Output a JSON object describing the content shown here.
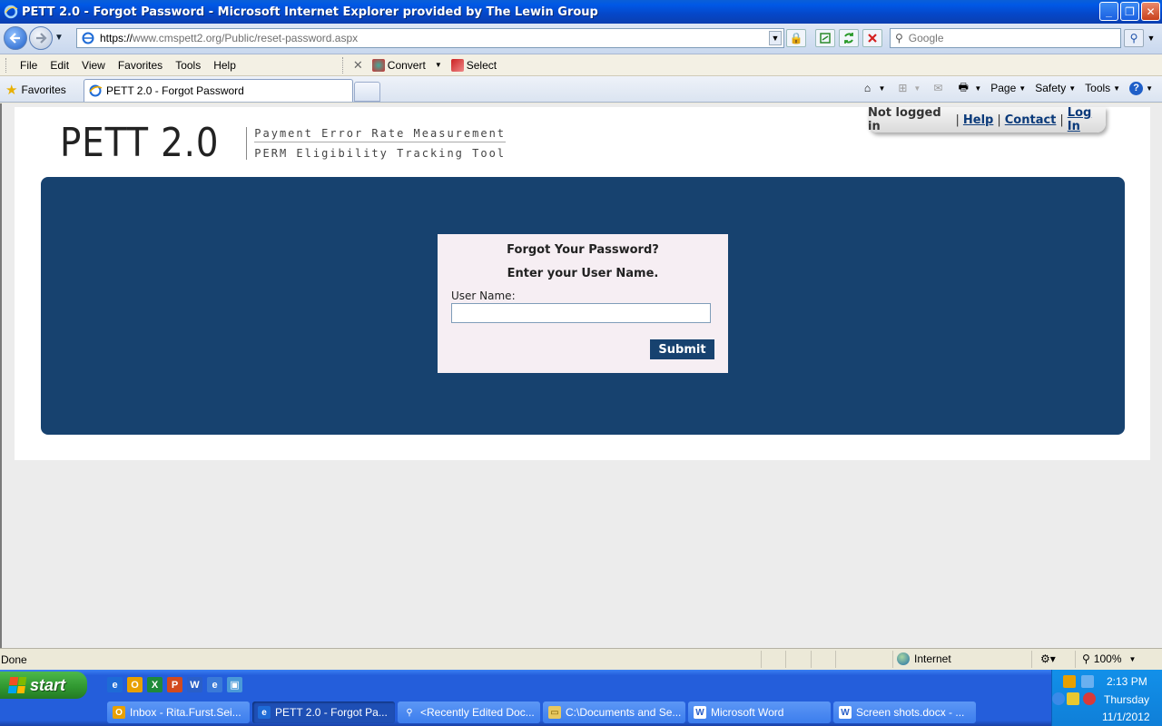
{
  "window": {
    "title": "PETT 2.0 - Forgot Password - Microsoft Internet Explorer provided by The Lewin Group",
    "min": "_",
    "restore": "❐",
    "close": "✕"
  },
  "address": {
    "scheme": "https://",
    "url_rest": "www.cmspett2.org/Public/reset-password.aspx",
    "search_placeholder": "Google"
  },
  "menu": {
    "items": [
      "File",
      "Edit",
      "View",
      "Favorites",
      "Tools",
      "Help"
    ],
    "convert": "Convert",
    "select": "Select"
  },
  "favbar": {
    "favorites": "Favorites",
    "tab_title": "PETT 2.0 - Forgot Password",
    "page": "Page",
    "safety": "Safety",
    "tools": "Tools"
  },
  "page": {
    "logo_big": "PETT 2.0",
    "logo_line1": "Payment Error Rate Measurement",
    "logo_line2": "PERM Eligibility Tracking Tool",
    "not_logged_in": "Not logged in",
    "help": "Help",
    "contact": "Contact",
    "login": "Log In",
    "heading1": "Forgot Your Password?",
    "heading2": "Enter your User Name.",
    "username_label": "User Name:",
    "username_value": "",
    "submit": "Submit",
    "colors": {
      "panel": "#17426f",
      "card": "#f6eef3"
    }
  },
  "status": {
    "text": "Done",
    "zone": "Internet",
    "zoom": "100%"
  },
  "taskbar": {
    "start": "start",
    "tasks": [
      "Inbox - Rita.Furst.Sei...",
      "PETT 2.0 - Forgot Pa...",
      "<Recently Edited Doc...",
      "C:\\Documents and Se...",
      "Microsoft Word",
      "Screen shots.docx - ..."
    ],
    "time": "2:13 PM",
    "day": "Thursday",
    "date": "11/1/2012"
  }
}
